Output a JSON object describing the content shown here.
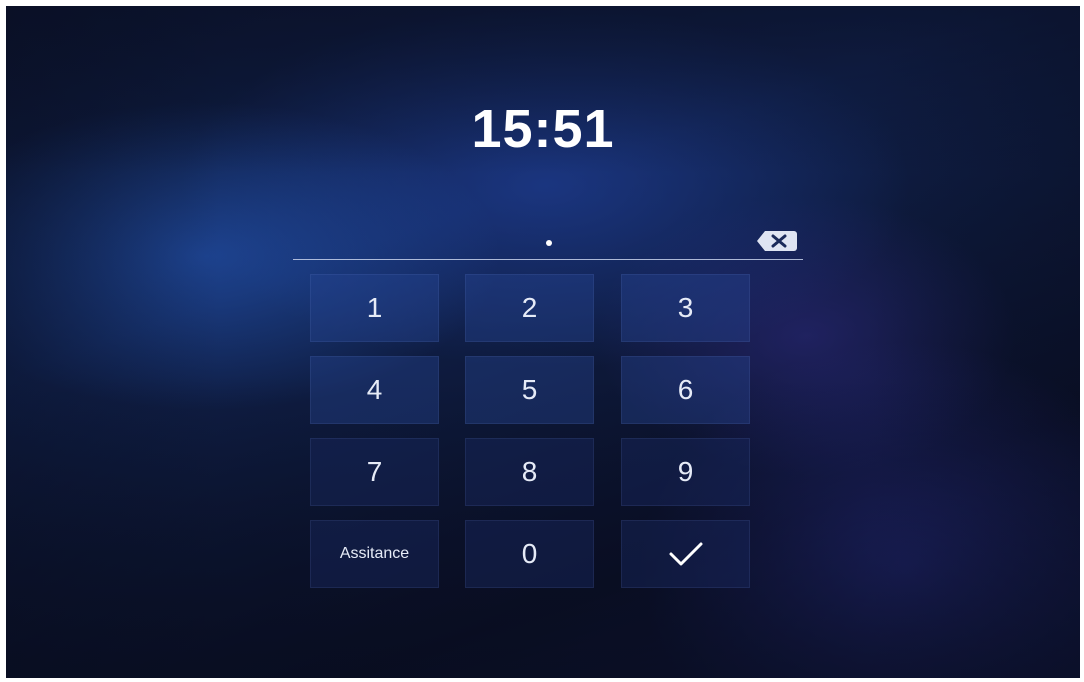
{
  "lock_screen": {
    "time": "15:51",
    "pin_dots_entered": 1
  },
  "icons": {
    "backspace": "backspace-icon",
    "confirm": "checkmark-icon"
  },
  "keypad": {
    "keys": [
      "1",
      "2",
      "3",
      "4",
      "5",
      "6",
      "7",
      "8",
      "9"
    ],
    "assistance_label": "Assitance",
    "zero": "0"
  },
  "colors": {
    "background_dark": "#0b1530",
    "accent_blue": "#2a55b8",
    "text": "#ffffff"
  }
}
